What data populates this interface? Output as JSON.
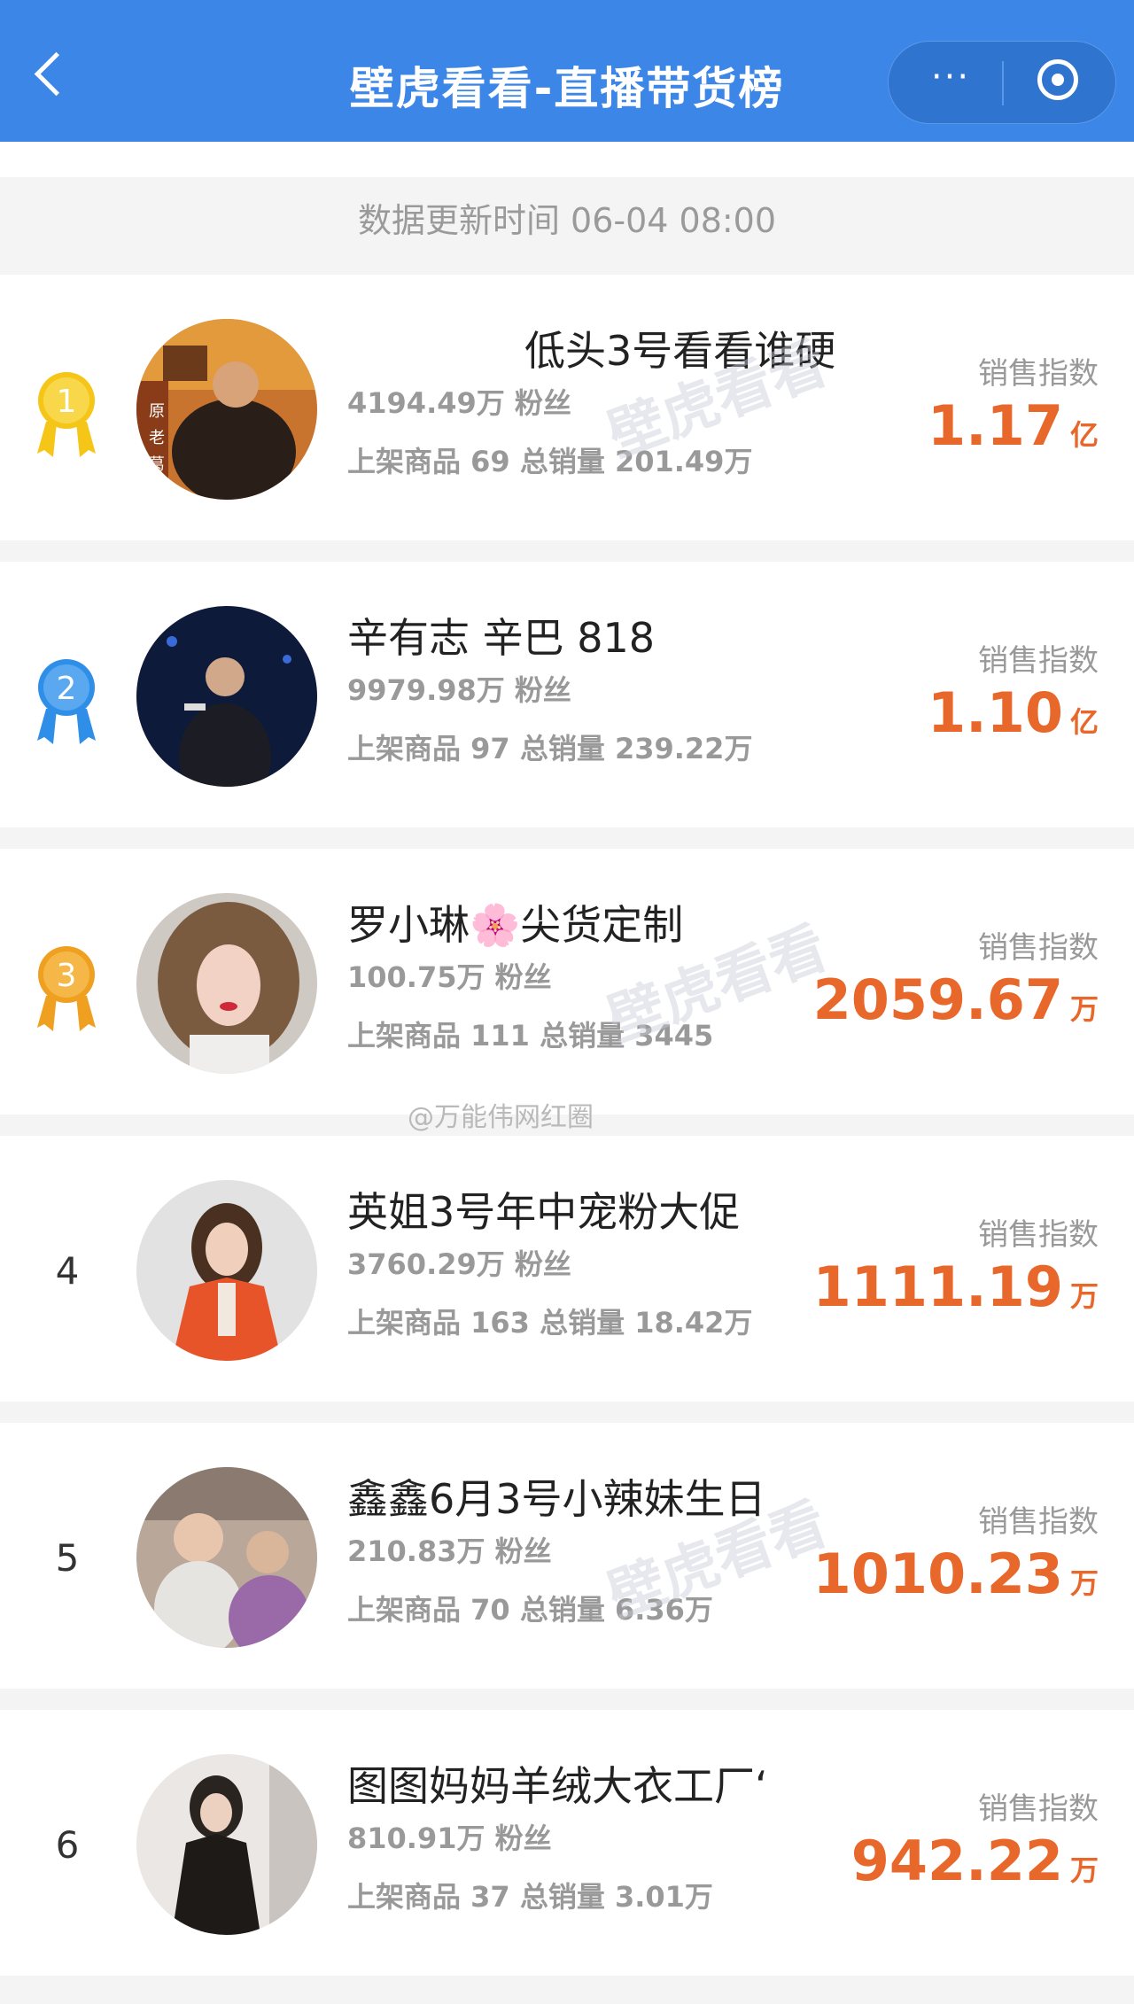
{
  "header": {
    "title": "壁虎看看-直播带货榜",
    "more_icon": "···"
  },
  "update_bar": {
    "text": "数据更新时间 06-04 08:00"
  },
  "watermark": {
    "brand": "壁虎看看",
    "social": "@万能伟网红圈"
  },
  "colors": {
    "header_bg": "#3b86e6",
    "accent": "#e8672a",
    "gold": "#f5c518",
    "blue": "#2f8fe8",
    "bronze": "#f0a020"
  },
  "rankings": [
    {
      "rank": "1",
      "medal": "gold",
      "name": "低头3号看看谁硬",
      "fans": "4194.49万 粉丝",
      "stats": "上架商品 69 总销量 201.49万",
      "index_label": "销售指数",
      "index_value": "1.17",
      "index_unit": "亿"
    },
    {
      "rank": "2",
      "medal": "blue",
      "name": "辛有志 辛巴 818",
      "fans": "9979.98万 粉丝",
      "stats": "上架商品 97 总销量 239.22万",
      "index_label": "销售指数",
      "index_value": "1.10",
      "index_unit": "亿"
    },
    {
      "rank": "3",
      "medal": "bronze",
      "name": "罗小琳🌸尖货定制",
      "fans": "100.75万 粉丝",
      "stats": "上架商品 111 总销量 3445",
      "index_label": "销售指数",
      "index_value": "2059.67",
      "index_unit": "万"
    },
    {
      "rank": "4",
      "medal": "",
      "name": "英姐3号年中宠粉大促",
      "fans": "3760.29万 粉丝",
      "stats": "上架商品 163 总销量 18.42万",
      "index_label": "销售指数",
      "index_value": "1111.19",
      "index_unit": "万"
    },
    {
      "rank": "5",
      "medal": "",
      "name": "鑫鑫6月3号小辣妹生日",
      "fans": "210.83万 粉丝",
      "stats": "上架商品 70 总销量 6.36万",
      "index_label": "销售指数",
      "index_value": "1010.23",
      "index_unit": "万"
    },
    {
      "rank": "6",
      "medal": "",
      "name": "图图妈妈羊绒大衣工厂‘",
      "fans": "810.91万 粉丝",
      "stats": "上架商品 37 总销量 3.01万",
      "index_label": "销售指数",
      "index_value": "942.22",
      "index_unit": "万"
    }
  ]
}
